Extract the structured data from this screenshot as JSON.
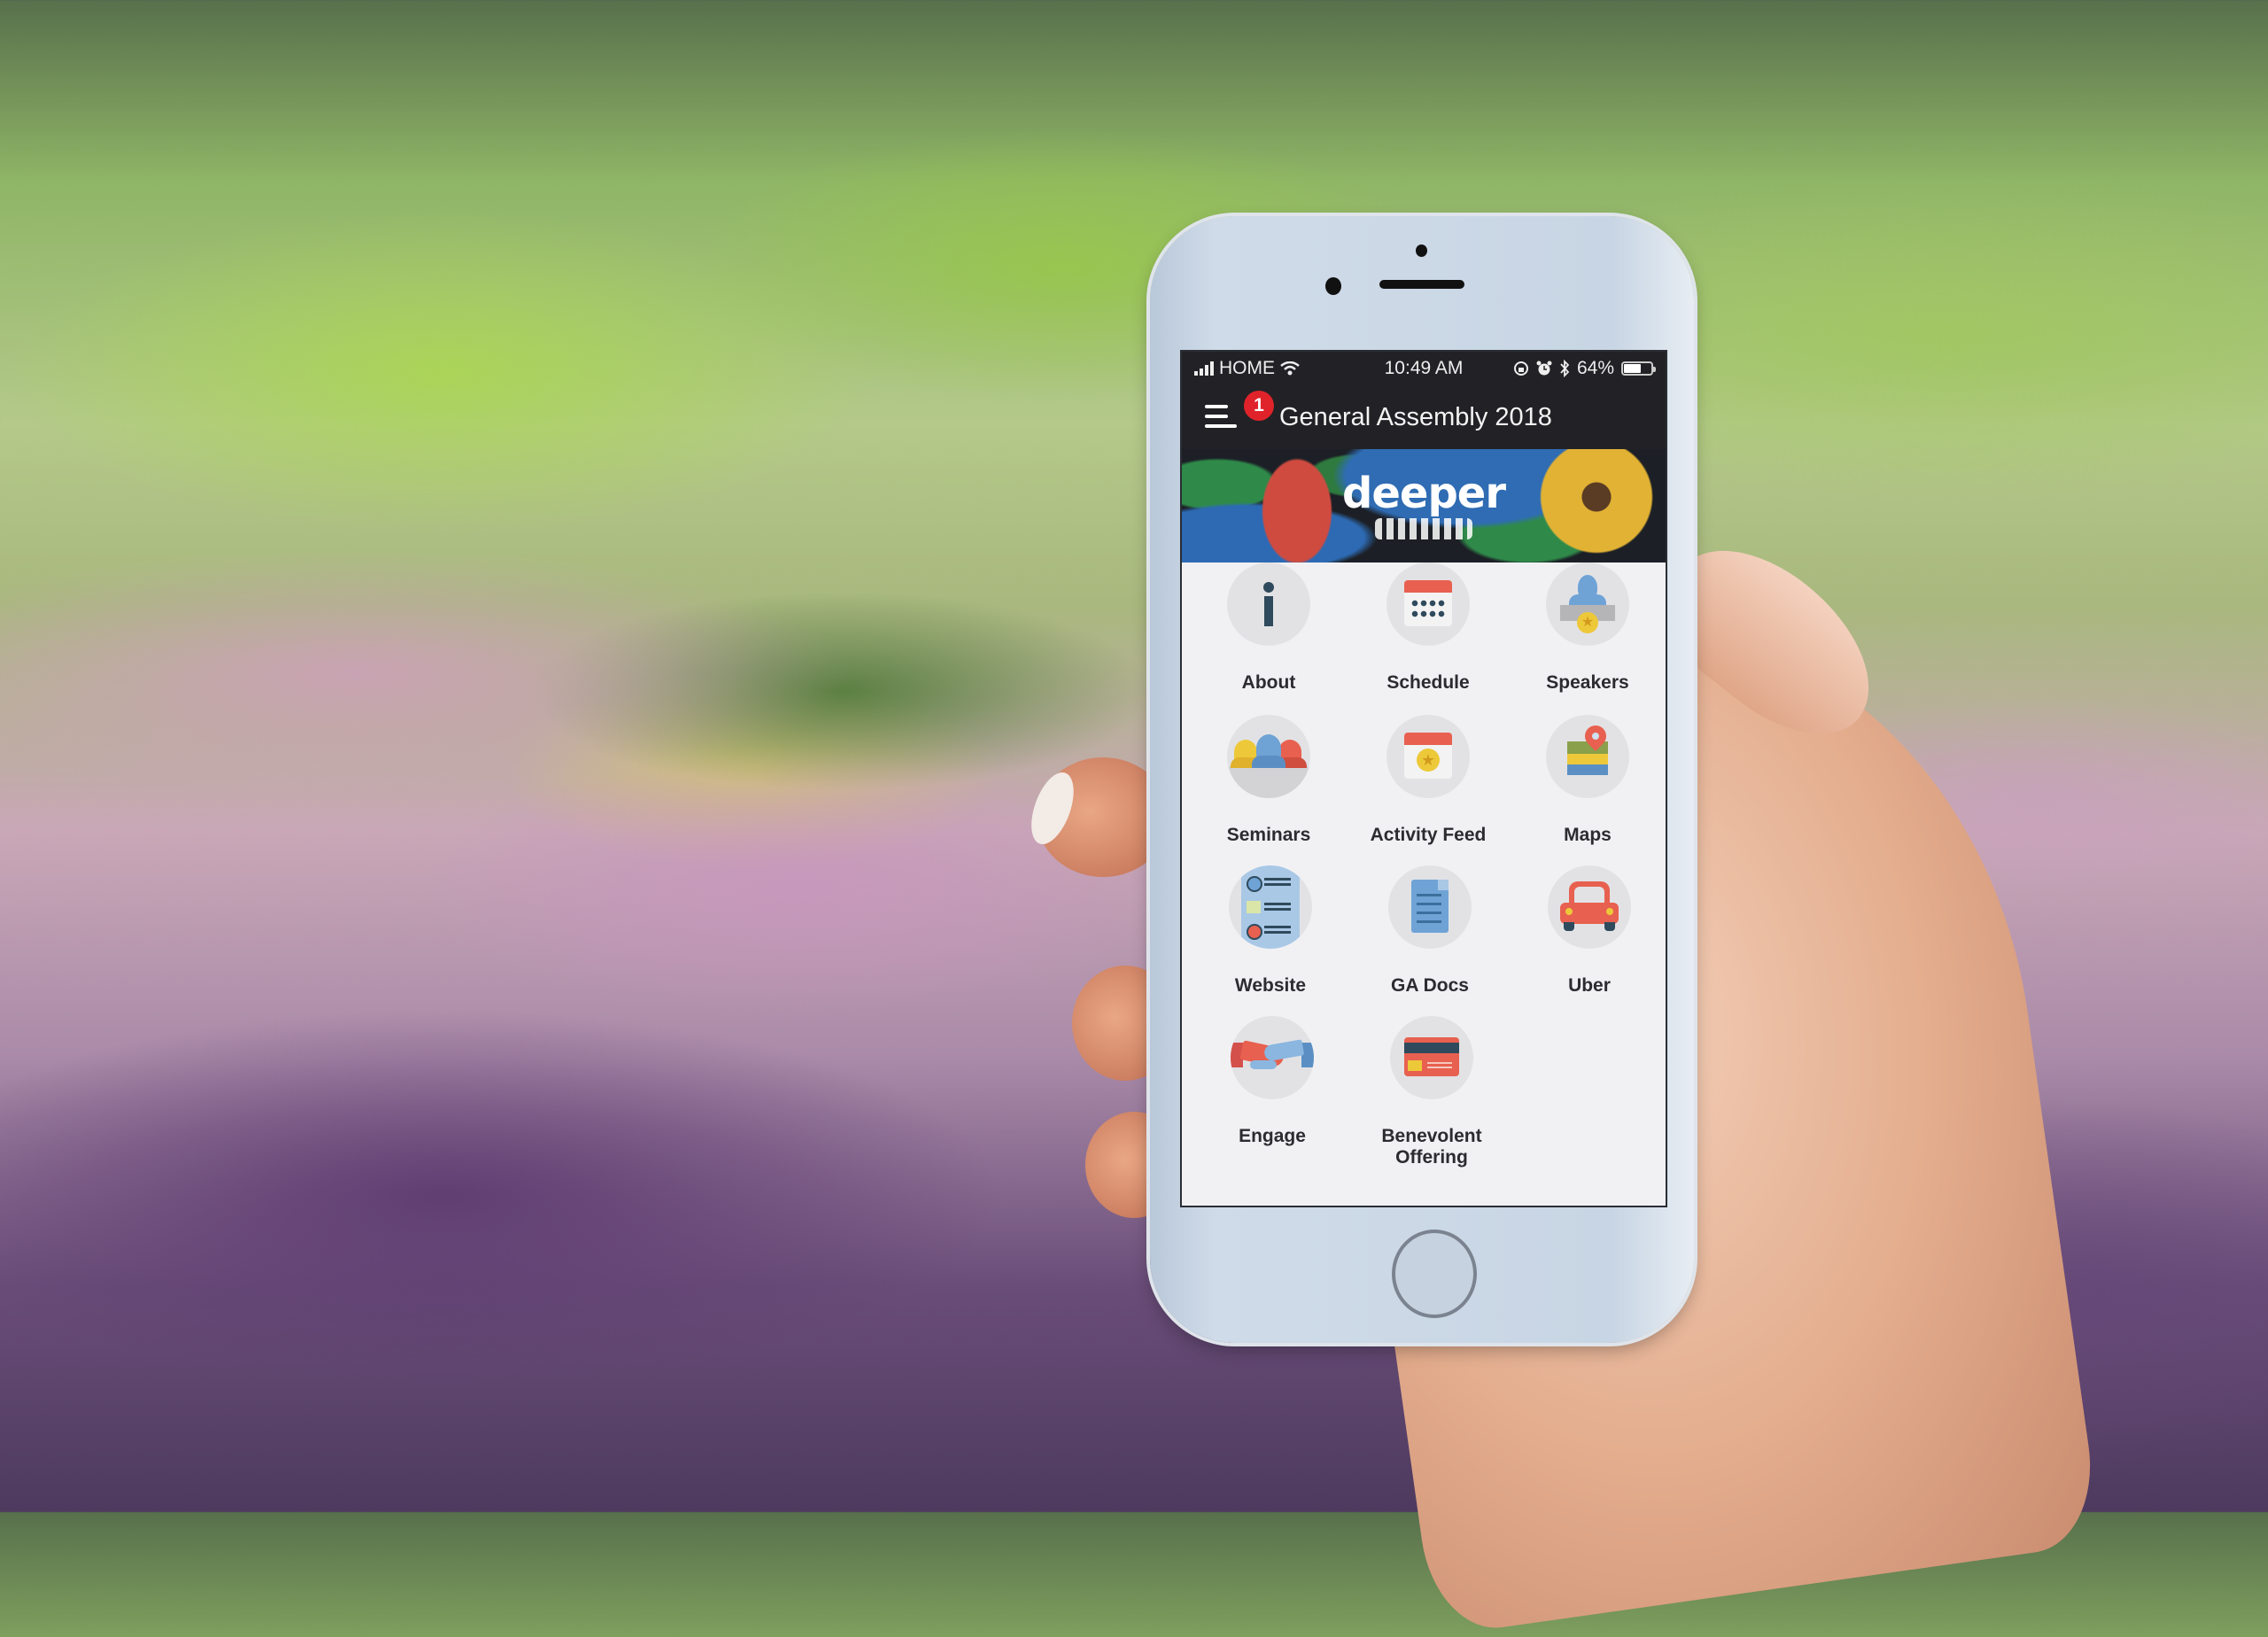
{
  "status_bar": {
    "carrier": "HOME",
    "time": "10:49 AM",
    "battery_percent": "64%",
    "battery_level": 0.64,
    "icons": [
      "signal-icon",
      "wifi-icon",
      "rotation-lock-icon",
      "alarm-icon",
      "bluetooth-icon",
      "battery-icon"
    ]
  },
  "nav": {
    "title": "General Assembly 2018",
    "menu_badge": "1",
    "menu_icon": "hamburger-menu-icon"
  },
  "banner": {
    "logo_text": "deeper"
  },
  "tiles": [
    {
      "label": "About",
      "icon": "info-icon"
    },
    {
      "label": "Schedule",
      "icon": "calendar-icon"
    },
    {
      "label": "Speakers",
      "icon": "speaker-podium-icon"
    },
    {
      "label": "Seminars",
      "icon": "group-icon"
    },
    {
      "label": "Activity Feed",
      "icon": "calendar-star-icon"
    },
    {
      "label": "Maps",
      "icon": "map-pin-icon"
    },
    {
      "label": "Website",
      "icon": "webpage-icon"
    },
    {
      "label": "GA Docs",
      "icon": "document-icon"
    },
    {
      "label": "Uber",
      "icon": "car-icon"
    },
    {
      "label": "Engage",
      "icon": "handshake-icon"
    },
    {
      "label": "Benevolent Offering",
      "icon": "credit-card-icon"
    }
  ],
  "colors": {
    "header_bg": "#222226",
    "badge": "#e0232a",
    "screen_bg": "#f1f1f4",
    "icon_circle": "#e2e2e5",
    "accent_red": "#e8604f",
    "accent_blue": "#6fa3d6",
    "accent_yellow": "#edc93a",
    "dark_slate": "#2f4a5c"
  }
}
